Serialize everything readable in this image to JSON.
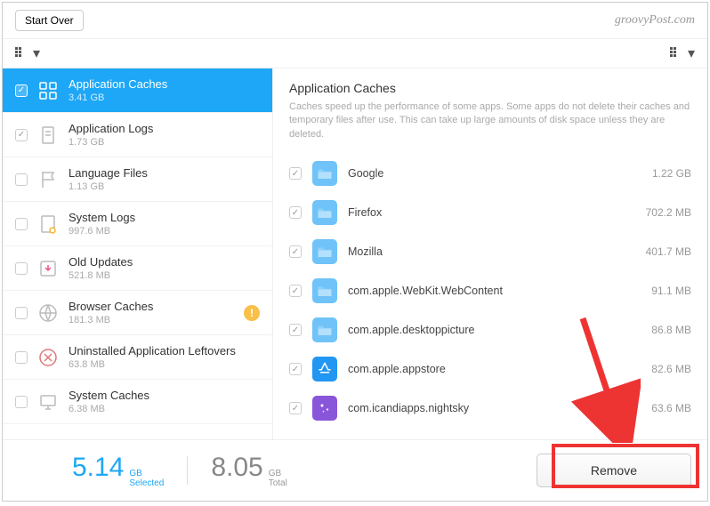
{
  "topbar": {
    "start_over": "Start Over",
    "brand": "groovyPost.com"
  },
  "categories": [
    {
      "title": "Application Caches",
      "size": "3.41 GB",
      "checked": true,
      "selected": true,
      "icon": "app-caches"
    },
    {
      "title": "Application Logs",
      "size": "1.73 GB",
      "checked": true,
      "selected": false,
      "icon": "app-logs"
    },
    {
      "title": "Language Files",
      "size": "1.13 GB",
      "checked": false,
      "selected": false,
      "icon": "language"
    },
    {
      "title": "System Logs",
      "size": "997.6 MB",
      "checked": false,
      "selected": false,
      "icon": "sys-logs"
    },
    {
      "title": "Old Updates",
      "size": "521.8 MB",
      "checked": false,
      "selected": false,
      "icon": "updates"
    },
    {
      "title": "Browser Caches",
      "size": "181.3 MB",
      "checked": false,
      "selected": false,
      "icon": "browser",
      "warn": true
    },
    {
      "title": "Uninstalled Application Leftovers",
      "size": "63.8 MB",
      "checked": false,
      "selected": false,
      "icon": "leftovers"
    },
    {
      "title": "System Caches",
      "size": "6.38 MB",
      "checked": false,
      "selected": false,
      "icon": "sys-caches"
    }
  ],
  "detail": {
    "heading": "Application Caches",
    "desc": "Caches speed up the performance of some apps. Some apps do not delete their caches and temporary files after use. This can take up large amounts of disk space unless they are deleted."
  },
  "items": [
    {
      "name": "Google",
      "size": "1.22 GB",
      "kind": "folder"
    },
    {
      "name": "Firefox",
      "size": "702.2 MB",
      "kind": "folder"
    },
    {
      "name": "Mozilla",
      "size": "401.7 MB",
      "kind": "folder"
    },
    {
      "name": "com.apple.WebKit.WebContent",
      "size": "91.1 MB",
      "kind": "folder"
    },
    {
      "name": "com.apple.desktoppicture",
      "size": "86.8 MB",
      "kind": "folder"
    },
    {
      "name": "com.apple.appstore",
      "size": "82.6 MB",
      "kind": "appstore"
    },
    {
      "name": "com.icandiapps.nightsky",
      "size": "63.6 MB",
      "kind": "night"
    }
  ],
  "footer": {
    "selected_num": "5.14",
    "selected_unit": "GB",
    "selected_label": "Selected",
    "total_num": "8.05",
    "total_unit": "GB",
    "total_label": "Total",
    "remove": "Remove"
  }
}
